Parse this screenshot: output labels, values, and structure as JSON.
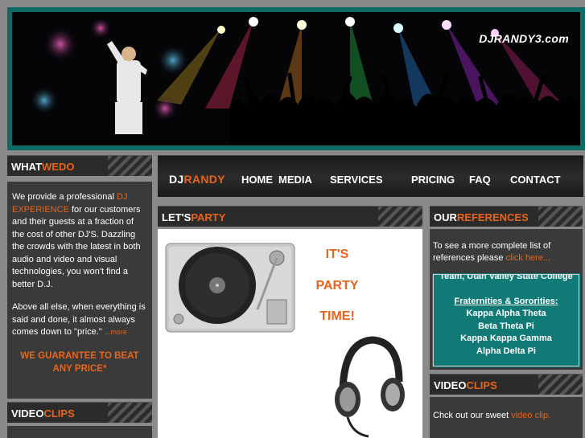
{
  "banner": {
    "site_name": "DJRANDY3.com"
  },
  "left": {
    "header_white": "WHAT",
    "header_orange": "WEDO",
    "p1_a": "We provide a professional ",
    "p1_link": "DJ EXPERIENCE",
    "p1_b": " for our customers and their guests at a fraction of the cost of other DJ'S. Dazzling the crowds with the latest in both audio and video and visual technologies, you won't find a better D.J.",
    "p2": "Above all else, when everything is said and done, it almost always comes down to \"price.\" ",
    "more": "...more",
    "guarantee": "WE GUARANTEE TO BEAT ANY PRICE*",
    "video_header_white": "VIDEO",
    "video_header_orange": "CLIPS"
  },
  "nav": {
    "brand_white": "DJ",
    "brand_orange": "RANDY",
    "items": [
      "HOME",
      "MEDIA",
      "SERVICES",
      "PRICING",
      "FAQ",
      "CONTACT"
    ]
  },
  "center": {
    "header_white": "LET'S",
    "header_orange": "PARTY",
    "line1": "IT'S",
    "line2": "PARTY",
    "line3": "TIME!"
  },
  "right": {
    "header_white": "OUR",
    "header_orange": "REFERENCES",
    "intro": "To see a more complete list of references please ",
    "link": "click here...",
    "ref_lines": [
      "Team, Utah Valley State College",
      "",
      "Fraternities & Sororities:",
      "Kappa Alpha Theta",
      "Beta Theta Pi",
      "Kappa Kappa Gamma",
      "Alpha Delta Pi"
    ],
    "video_header_white": "VIDEO",
    "video_header_orange": "CLIPS",
    "video_text": "Chck out our sweet ",
    "video_link": "video clip."
  },
  "colors": {
    "accent": "#e8641b",
    "teal": "#127a76",
    "panel": "#3a3a3a"
  }
}
